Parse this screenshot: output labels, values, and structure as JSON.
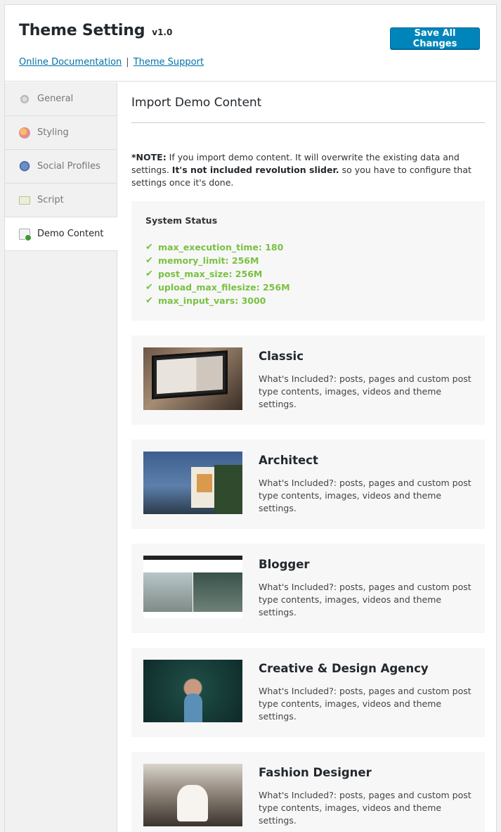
{
  "header": {
    "title": "Theme Setting",
    "version": "v1.0",
    "doc_link": "Online Documentation",
    "separator": "|",
    "support_link": "Theme Support",
    "save_label": "Save All Changes"
  },
  "sidebar": {
    "items": [
      {
        "label": "General",
        "icon": "gear-icon"
      },
      {
        "label": "Styling",
        "icon": "palette-icon"
      },
      {
        "label": "Social Profiles",
        "icon": "social-icon"
      },
      {
        "label": "Script",
        "icon": "script-icon"
      },
      {
        "label": "Demo Content",
        "icon": "demo-content-icon",
        "active": true
      }
    ]
  },
  "main": {
    "section_title": "Import Demo Content",
    "note": {
      "label": "*NOTE:",
      "text1": " If you import demo content. It will overwrite the existing data and settings. ",
      "bold2": "It's not included revolution slider.",
      "text2": " so you have to configure that settings once it's done."
    },
    "system_status": {
      "title": "System Status",
      "items": [
        "max_execution_time: 180",
        "memory_limit: 256M",
        "post_max_size: 256M",
        "upload_max_filesize: 256M",
        "max_input_vars: 3000"
      ],
      "ok_color": "#7ac142"
    },
    "demos": [
      {
        "name": "Classic",
        "desc": "What's Included?: posts, pages and custom post type contents, images, videos and theme settings."
      },
      {
        "name": "Architect",
        "desc": "What's Included?: posts, pages and custom post type contents, images, videos and theme settings."
      },
      {
        "name": "Blogger",
        "desc": "What's Included?: posts, pages and custom post type contents, images, videos and theme settings."
      },
      {
        "name": "Creative & Design Agency",
        "desc": "What's Included?: posts, pages and custom post type contents, images, videos and theme settings."
      },
      {
        "name": "Fashion Designer",
        "desc": "What's Included?: posts, pages and custom post type contents, images, videos and theme settings."
      }
    ]
  },
  "colors": {
    "primary_button": "#0085ba",
    "link": "#0073aa"
  }
}
